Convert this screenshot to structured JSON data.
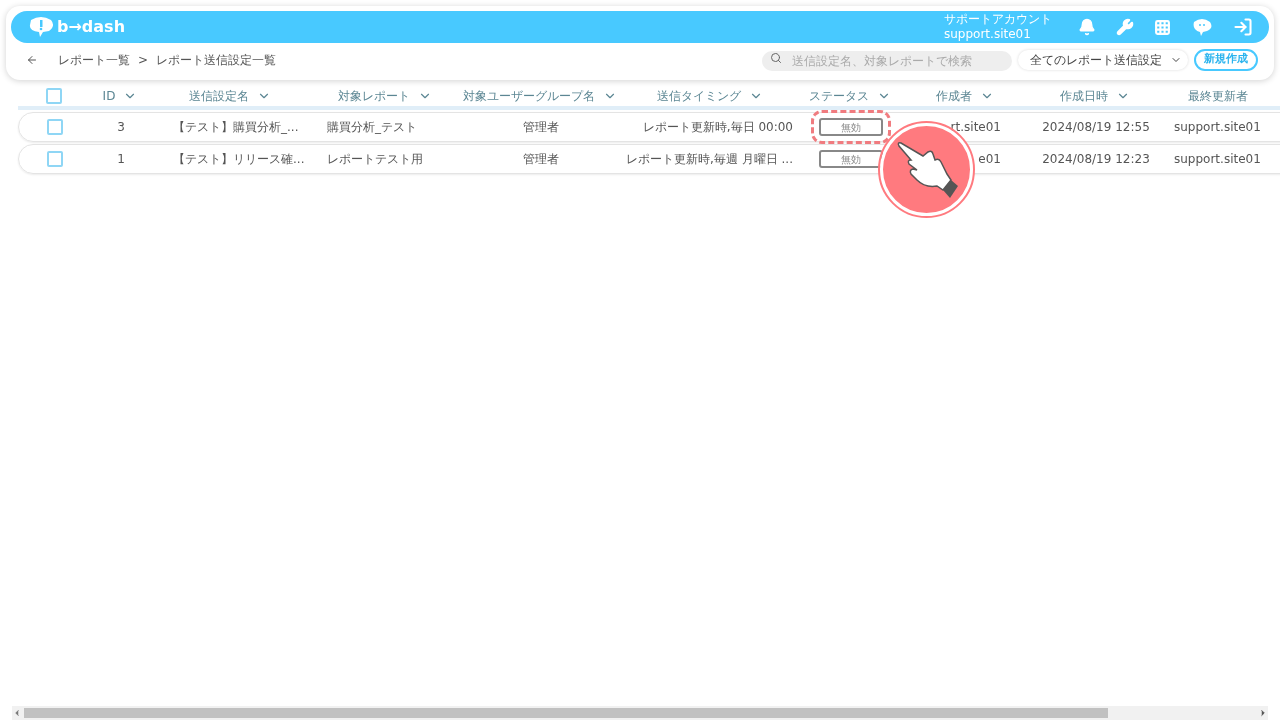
{
  "header": {
    "logo": "b→dash",
    "account_label": "サポートアカウント",
    "account_id": "support.site01"
  },
  "breadcrumb": [
    "レポート一覧",
    "レポート送信設定一覧"
  ],
  "breadcrumb_separator": ">",
  "search": {
    "placeholder": "送信設定名、対象レポートで検索"
  },
  "filter": {
    "value": "全てのレポート送信設定"
  },
  "create_button": "新規作成",
  "table": {
    "select_all_checked": false,
    "columns": [
      {
        "label": "ID",
        "sortable": true
      },
      {
        "label": "送信設定名",
        "sortable": true
      },
      {
        "label": "対象レポート",
        "sortable": true
      },
      {
        "label": "対象ユーザーグループ名",
        "sortable": true
      },
      {
        "label": "送信タイミング",
        "sortable": true
      },
      {
        "label": "ステータス",
        "sortable": true
      },
      {
        "label": "作成者",
        "sortable": true
      },
      {
        "label": "作成日時",
        "sortable": true
      },
      {
        "label": "最終更新者",
        "sortable": false
      }
    ],
    "rows": [
      {
        "checked": false,
        "cells": [
          "3",
          "【テスト】購買分析_...",
          "購買分析_テスト",
          "管理者",
          "レポート更新時,毎日 00:00",
          "無効",
          "rt.site01",
          "2024/08/19 12:55",
          "support.site01"
        ],
        "highlighted": true
      },
      {
        "checked": false,
        "cells": [
          "1",
          "【テスト】リリース確...",
          "レポートテスト用",
          "管理者",
          "レポート更新時,毎週 月曜日 ...",
          "無効",
          "e01",
          "2024/08/19 12:23",
          "support.site01"
        ],
        "highlighted": false
      }
    ]
  }
}
